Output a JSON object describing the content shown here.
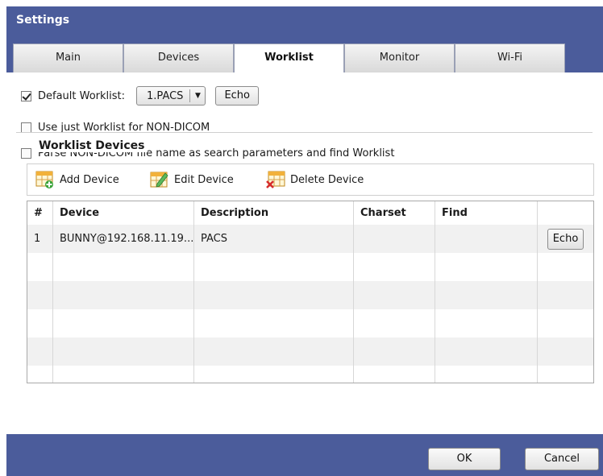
{
  "window": {
    "title": "Settings"
  },
  "tabs": [
    {
      "label": "Main",
      "active": false
    },
    {
      "label": "Devices",
      "active": false
    },
    {
      "label": "Worklist",
      "active": true
    },
    {
      "label": "Monitor",
      "active": false
    },
    {
      "label": "Wi-Fi",
      "active": false
    }
  ],
  "options": {
    "default_worklist": {
      "label": "Default Worklist:",
      "checked": true,
      "selected": "1.PACS",
      "echo_label": "Echo"
    },
    "use_just_worklist": {
      "label": "Use just Worklist for NON-DICOM",
      "checked": false
    },
    "parse_non_dicom": {
      "label": "Parse NON-DICOM file name as search parameters and find Worklist",
      "checked": false
    }
  },
  "worklist_devices": {
    "group_title": "Worklist Devices",
    "toolbar": {
      "add_label": "Add Device",
      "edit_label": "Edit Device",
      "delete_label": "Delete Device"
    },
    "columns": [
      "#",
      "Device",
      "Description",
      "Charset",
      "Find",
      ""
    ],
    "rows": [
      {
        "index": "1",
        "device": "BUNNY@192.168.11.19...",
        "description": "PACS",
        "charset": "",
        "find": "",
        "action_label": "Echo"
      }
    ]
  },
  "footer": {
    "ok_label": "OK",
    "cancel_label": "Cancel"
  },
  "colors": {
    "chrome": "#4b5c9b",
    "stripe": "#f1f1f1"
  },
  "icons": [
    "add-device-icon",
    "edit-device-icon",
    "delete-device-icon",
    "dropdown-arrow-icon",
    "checkmark-icon"
  ]
}
